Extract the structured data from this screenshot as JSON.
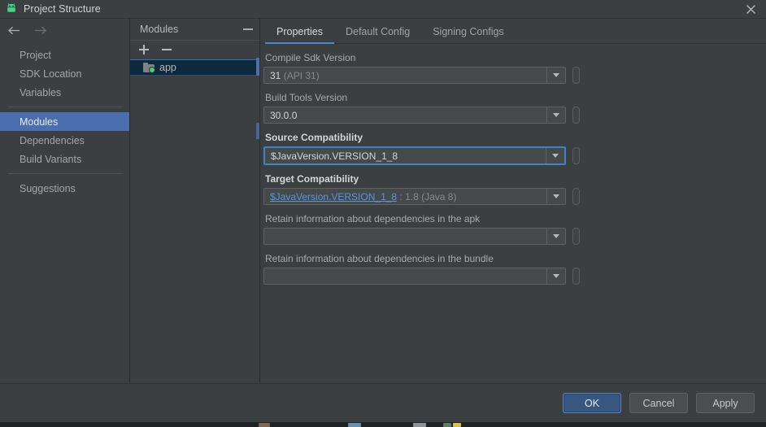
{
  "window": {
    "title": "Project Structure",
    "app_icon": "android-robot-icon",
    "close_icon": "close-icon"
  },
  "nav": {
    "back_icon": "arrow-left-icon",
    "forward_icon": "arrow-right-icon",
    "groups": [
      {
        "items": [
          {
            "label": "Project",
            "selected": false
          },
          {
            "label": "SDK Location",
            "selected": false
          },
          {
            "label": "Variables",
            "selected": false
          }
        ]
      },
      {
        "items": [
          {
            "label": "Modules",
            "selected": true
          },
          {
            "label": "Dependencies",
            "selected": false
          },
          {
            "label": "Build Variants",
            "selected": false
          }
        ]
      },
      {
        "items": [
          {
            "label": "Suggestions",
            "selected": false
          }
        ]
      }
    ]
  },
  "modules_panel": {
    "title": "Modules",
    "collapse_icon": "collapse-minus-icon",
    "toolbar": {
      "add_icon": "plus-icon",
      "remove_icon": "minus-icon"
    },
    "items": [
      {
        "label": "app",
        "icon": "module-folder-icon",
        "selected": true
      }
    ]
  },
  "tabs": [
    {
      "label": "Properties",
      "active": true
    },
    {
      "label": "Default Config",
      "active": false
    },
    {
      "label": "Signing Configs",
      "active": false
    }
  ],
  "fields": [
    {
      "label": "Compile Sdk Version",
      "bold": false,
      "focused": false,
      "value_main": "31",
      "value_main_style": "bright",
      "value_suffix": " (API 31)",
      "value_suffix_style": "dim",
      "dropdown_icon": "chevron-down-icon",
      "variable_icon": "variable-pill-icon"
    },
    {
      "label": "Build Tools Version",
      "bold": false,
      "focused": false,
      "value_main": "30.0.0",
      "value_main_style": "bright",
      "value_suffix": "",
      "value_suffix_style": "dim",
      "dropdown_icon": "chevron-down-icon",
      "variable_icon": "variable-pill-icon"
    },
    {
      "label": "Source Compatibility",
      "bold": true,
      "focused": true,
      "value_main": "$JavaVersion.VERSION_1_8",
      "value_main_style": "bright",
      "value_suffix": "",
      "value_suffix_style": "dim",
      "dropdown_icon": "chevron-down-icon",
      "variable_icon": "variable-pill-icon"
    },
    {
      "label": "Target Compatibility",
      "bold": true,
      "focused": false,
      "value_main": "$JavaVersion.VERSION_1_8",
      "value_main_style": "link",
      "value_suffix": " : 1.8 (Java 8)",
      "value_suffix_style": "dim",
      "dropdown_icon": "chevron-down-icon",
      "variable_icon": "variable-pill-icon"
    },
    {
      "label": "Retain information about dependencies in the apk",
      "bold": false,
      "focused": false,
      "value_main": "",
      "value_main_style": "bright",
      "value_suffix": "",
      "value_suffix_style": "dim",
      "dropdown_icon": "chevron-down-icon",
      "variable_icon": "variable-pill-icon"
    },
    {
      "label": "Retain information about dependencies in the bundle",
      "bold": false,
      "focused": false,
      "value_main": "",
      "value_main_style": "bright",
      "value_suffix": "",
      "value_suffix_style": "dim",
      "dropdown_icon": "chevron-down-icon",
      "variable_icon": "variable-pill-icon"
    }
  ],
  "footer": {
    "buttons": [
      {
        "label": "OK",
        "primary": true
      },
      {
        "label": "Cancel",
        "primary": false
      },
      {
        "label": "Apply",
        "primary": false
      }
    ]
  },
  "colors": {
    "background": "#3c3f41",
    "accent_blue": "#4b6eaf",
    "tab_underline": "#4a88c7",
    "link_blue": "#5b93d9",
    "selected_row": "#0d293e",
    "android_green": "#4ecb71",
    "primary_button": "#365880"
  }
}
